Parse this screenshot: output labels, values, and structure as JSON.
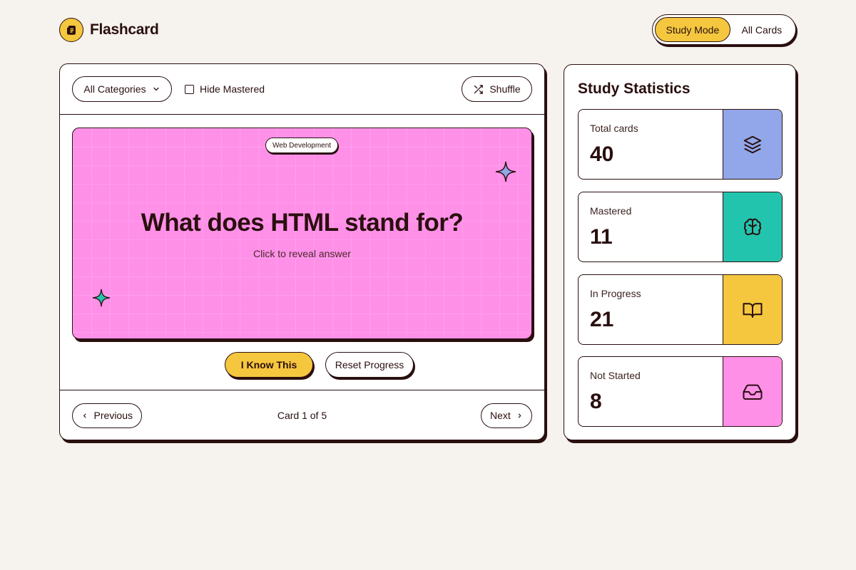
{
  "brand": {
    "name": "Flashcard"
  },
  "modes": {
    "active": "Study Mode",
    "inactive": "All Cards"
  },
  "toolbar": {
    "category": "All Categories",
    "hide_mastered": "Hide Mastered",
    "shuffle": "Shuffle"
  },
  "card": {
    "category": "Web Development",
    "question": "What does HTML stand for?",
    "hint": "Click to reveal answer",
    "color": "#ff90e8"
  },
  "actions": {
    "know": "I Know This",
    "reset": "Reset Progress"
  },
  "footer": {
    "previous": "Previous",
    "counter": "Card 1 of 5",
    "next": "Next"
  },
  "stats": {
    "title": "Study Statistics",
    "items": [
      {
        "label": "Total cards",
        "value": "40",
        "icon": "layers-icon",
        "color": "#92a7ea"
      },
      {
        "label": "Mastered",
        "value": "11",
        "icon": "brain-icon",
        "color": "#23c4ad"
      },
      {
        "label": "In Progress",
        "value": "21",
        "icon": "book-open-icon",
        "color": "#f5c73e"
      },
      {
        "label": "Not Started",
        "value": "8",
        "icon": "inbox-icon",
        "color": "#ff90e8"
      }
    ]
  }
}
